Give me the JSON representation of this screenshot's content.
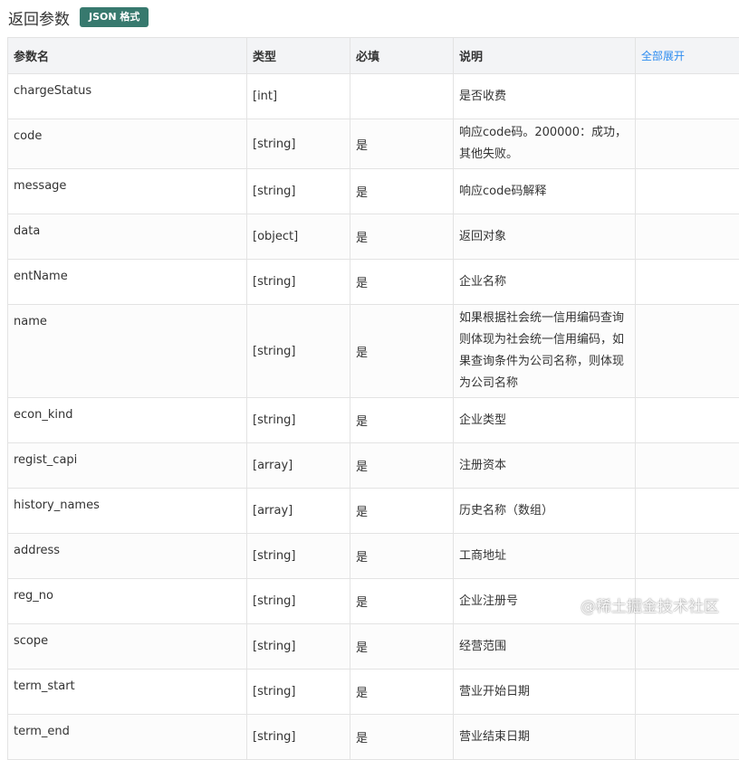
{
  "header": {
    "title": "返回参数",
    "badge": "JSON 格式"
  },
  "table": {
    "columns": [
      "参数名",
      "类型",
      "必填",
      "说明"
    ],
    "expand_label": "全部展开",
    "rows": [
      {
        "name": "chargeStatus",
        "type": "[int]",
        "required": "",
        "desc": "是否收费"
      },
      {
        "name": "code",
        "type": "[string]",
        "required": "是",
        "desc": "响应code码。200000：成功，其他失败。"
      },
      {
        "name": "message",
        "type": "[string]",
        "required": "是",
        "desc": "响应code码解释"
      },
      {
        "name": "data",
        "type": "[object]",
        "required": "是",
        "desc": "返回对象"
      },
      {
        "name": "entName",
        "type": "[string]",
        "required": "是",
        "desc": "企业名称"
      },
      {
        "name": "name",
        "type": "[string]",
        "required": "是",
        "desc": "如果根据社会统一信用编码查询则体现为社会统一信用编码，如果查询条件为公司名称，则体现为公司名称"
      },
      {
        "name": "econ_kind",
        "type": "[string]",
        "required": "是",
        "desc": "企业类型"
      },
      {
        "name": "regist_capi",
        "type": "[array]",
        "required": "是",
        "desc": "注册资本"
      },
      {
        "name": "history_names",
        "type": "[array]",
        "required": "是",
        "desc": "历史名称（数组）"
      },
      {
        "name": "address",
        "type": "[string]",
        "required": "是",
        "desc": "工商地址"
      },
      {
        "name": "reg_no",
        "type": "[string]",
        "required": "是",
        "desc": "企业注册号"
      },
      {
        "name": "scope",
        "type": "[string]",
        "required": "是",
        "desc": "经营范围"
      },
      {
        "name": "term_start",
        "type": "[string]",
        "required": "是",
        "desc": "营业开始日期"
      },
      {
        "name": "term_end",
        "type": "[string]",
        "required": "是",
        "desc": "营业结束日期"
      }
    ]
  },
  "watermark": "@稀土掘金技术社区"
}
